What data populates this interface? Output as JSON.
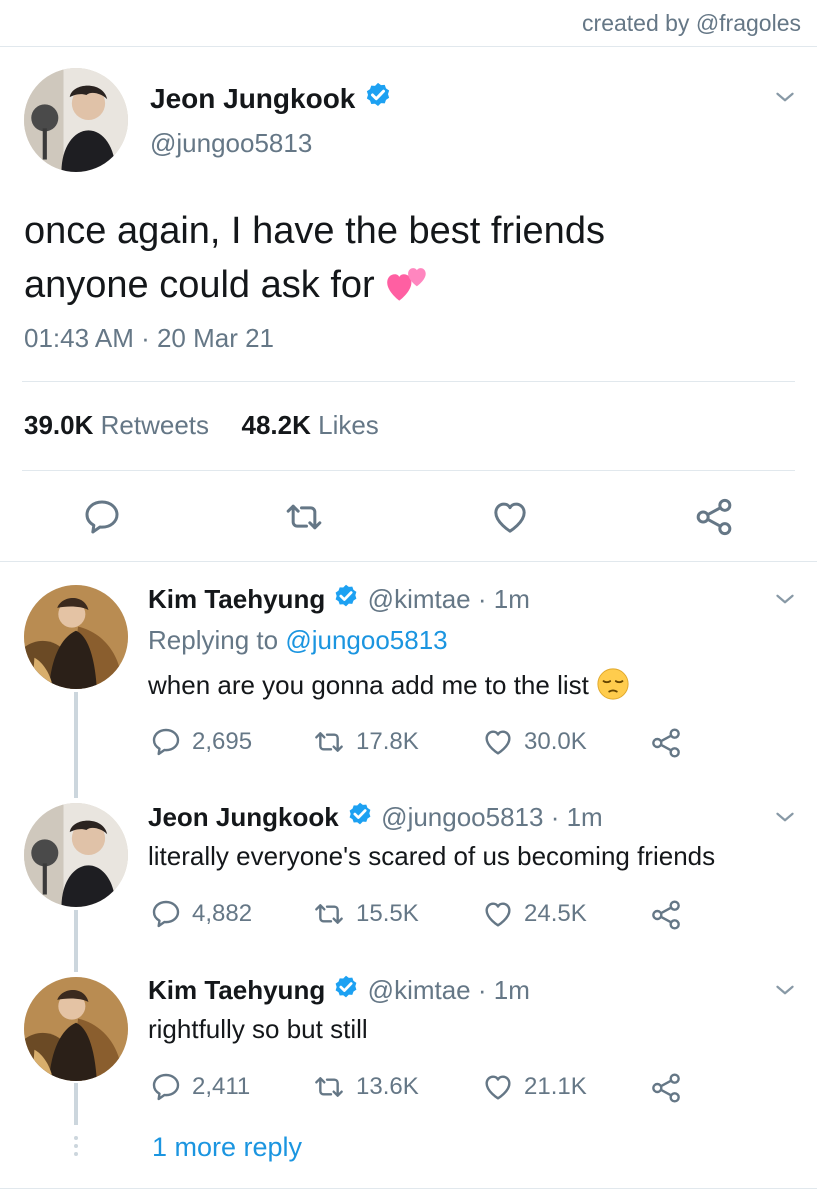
{
  "credit": "created by @fragoles",
  "main_tweet": {
    "author_name": "Jeon Jungkook",
    "handle": "@jungoo5813",
    "text_line1": "once again, I have the best friends",
    "text_line2": "anyone could ask for",
    "emoji": "💕",
    "timestamp": "01:43 AM · 20 Mar 21",
    "retweets_count": "39.0K",
    "retweets_label": "Retweets",
    "likes_count": "48.2K",
    "likes_label": "Likes"
  },
  "replies": [
    {
      "author_name": "Kim Taehyung",
      "handle": "@kimtae",
      "age": "· 1m",
      "replying_prefix": "Replying to",
      "replying_to": "@jungoo5813",
      "text": "when are you gonna add me to the list",
      "emoji": "😔",
      "replies": "2,695",
      "retweets": "17.8K",
      "likes": "30.0K"
    },
    {
      "author_name": "Jeon Jungkook",
      "handle": "@jungoo5813",
      "age": "· 1m",
      "text": "literally everyone's scared of us becoming friends",
      "replies": "4,882",
      "retweets": "15.5K",
      "likes": "24.5K"
    },
    {
      "author_name": "Kim Taehyung",
      "handle": "@kimtae",
      "age": "· 1m",
      "text": "rightfully so but still",
      "replies": "2,411",
      "retweets": "13.6K",
      "likes": "21.1K"
    }
  ],
  "more_replies": "1 more reply",
  "colors": {
    "link": "#1b95e0",
    "verified": "#1da1f2",
    "muted": "#657786",
    "divider": "#e1e8ed"
  }
}
